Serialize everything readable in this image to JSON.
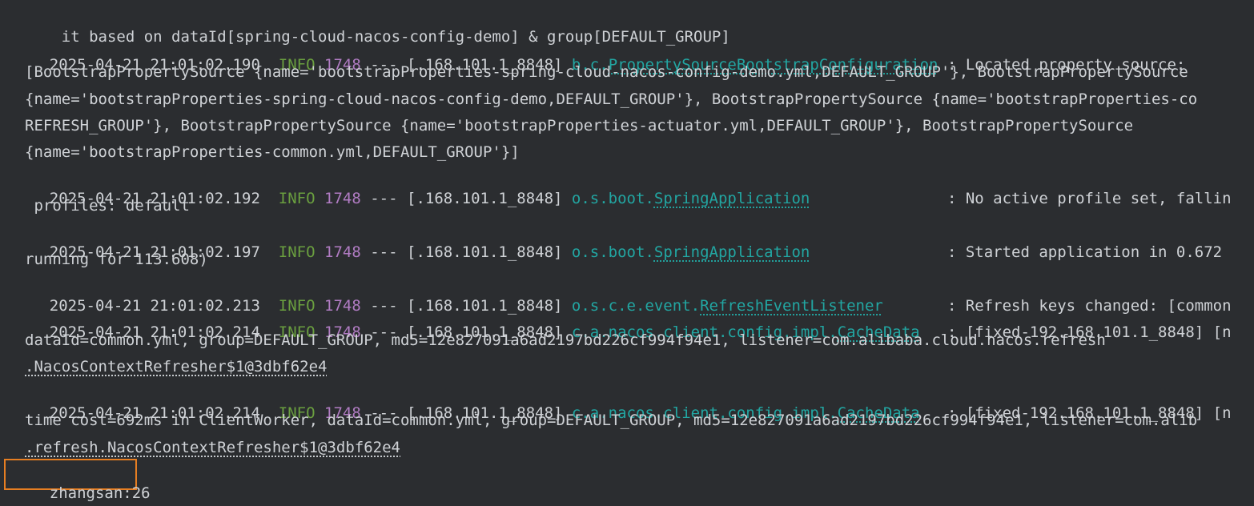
{
  "console": {
    "continuation_0": "it based on dataId[spring-cloud-nacos-config-demo] & group[DEFAULT_GROUP]",
    "entries": [
      {
        "date": "2025-04-21",
        "time": "21:01:02.190",
        "level": "INFO",
        "pid": "1748",
        "sep": "---",
        "thread": "[.168.101.1_8848]",
        "logger_pkg": "b.c.",
        "logger_cls": "PropertySourceBootstrapConfiguration",
        "msg": ": Located property source:",
        "cont": [
          "[BootstrapPropertySource {name='bootstrapProperties-spring-cloud-nacos-config-demo.yml,DEFAULT_GROUP'}, BootstrapPropertySource",
          "{name='bootstrapProperties-spring-cloud-nacos-config-demo,DEFAULT_GROUP'}, BootstrapPropertySource {name='bootstrapProperties-co",
          "REFRESH_GROUP'}, BootstrapPropertySource {name='bootstrapProperties-actuator.yml,DEFAULT_GROUP'}, BootstrapPropertySource",
          "{name='bootstrapProperties-common.yml,DEFAULT_GROUP'}]"
        ]
      },
      {
        "date": "2025-04-21",
        "time": "21:01:02.192",
        "level": "INFO",
        "pid": "1748",
        "sep": "---",
        "thread": "[.168.101.1_8848]",
        "logger_pkg": "o.s.boot.",
        "logger_cls": "SpringApplication",
        "msg": ": No active profile set, fallin",
        "cont": [
          " profiles: default"
        ]
      },
      {
        "date": "2025-04-21",
        "time": "21:01:02.197",
        "level": "INFO",
        "pid": "1748",
        "sep": "---",
        "thread": "[.168.101.1_8848]",
        "logger_pkg": "o.s.boot.",
        "logger_cls": "SpringApplication",
        "msg": ": Started application in 0.672",
        "cont": [
          "running for 113.608)"
        ]
      },
      {
        "date": "2025-04-21",
        "time": "21:01:02.213",
        "level": "INFO",
        "pid": "1748",
        "sep": "---",
        "thread": "[.168.101.1_8848]",
        "logger_pkg": "o.s.c.e.event.",
        "logger_cls": "RefreshEventListener",
        "msg": ": Refresh keys changed: [common",
        "cont": []
      },
      {
        "date": "2025-04-21",
        "time": "21:01:02.214",
        "level": "INFO",
        "pid": "1748",
        "sep": "---",
        "thread": "[.168.101.1_8848]",
        "logger_pkg": "c.a.nacos.client.config.impl.",
        "logger_cls": "CacheData",
        "msg": ": [fixed-192.168.101.1_8848] [n",
        "cont": [
          "dataId=common.yml, group=DEFAULT_GROUP, md5=12e827091a6ad2197bd226cf994f94e1, listener=com.alibaba.cloud.nacos.refresh",
          ".NacosContextRefresher$1@3dbf62e4"
        ]
      },
      {
        "date": "2025-04-21",
        "time": "21:01:02.214",
        "level": "INFO",
        "pid": "1748",
        "sep": "---",
        "thread": "[.168.101.1_8848]",
        "logger_pkg": "c.a.nacos.client.config.impl.",
        "logger_cls": "CacheData",
        "msg": ": [fixed-192.168.101.1_8848] [n",
        "cont": [
          "time cost=692ms in ClientWorker, dataId=common.yml, group=DEFAULT_GROUP, md5=12e827091a6ad2197bd226cf994f94e1, listener=com.alib",
          ".refresh.NacosContextRefresher$1@3dbf62e4"
        ]
      }
    ],
    "output": "zhangsan:26"
  },
  "colors": {
    "background": "#2b2d30",
    "text": "#cfd2d6",
    "level_info": "#6a9f3f",
    "pid": "#b17cc3",
    "logger": "#22a6a2",
    "highlight_border": "#e67e22"
  }
}
